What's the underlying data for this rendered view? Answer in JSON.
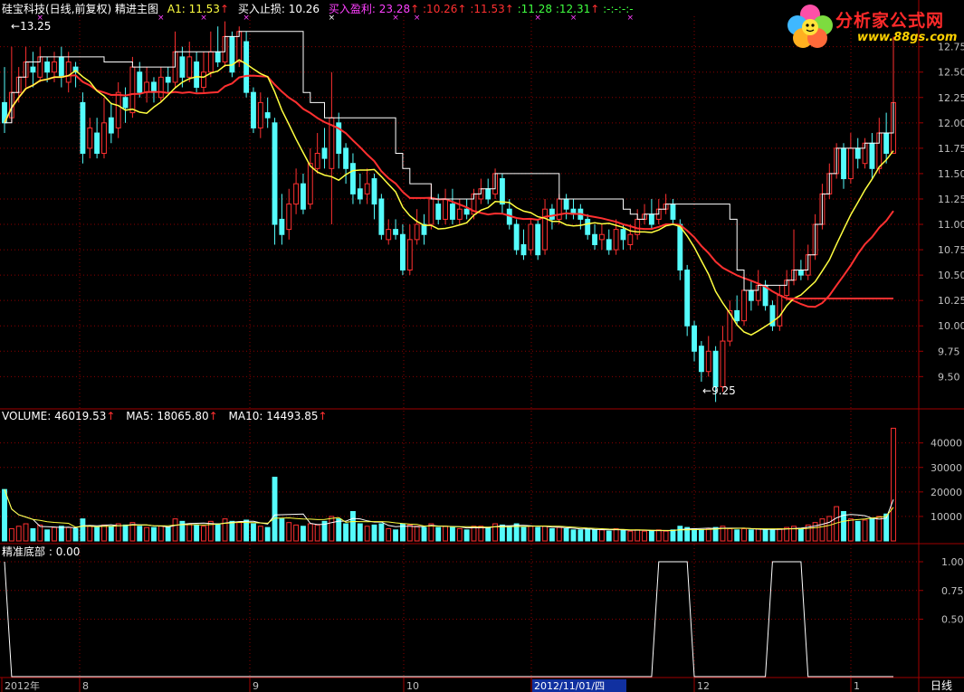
{
  "header": {
    "stock_title": "硅宝科技(日线,前复权)",
    "indicator_name": "精进主图",
    "a1_label": "A1:",
    "a1_value": "11.53",
    "stop_label": "买入止损:",
    "stop_value": "10.26",
    "profit_label": "买入盈利:",
    "profit_value": "23.28",
    "extra_values": [
      ":10.26",
      ":11.53",
      ":11.28",
      ":12.31",
      ":-",
      ":-",
      ":-",
      ":-"
    ],
    "up_arrow": "↑"
  },
  "annotations": {
    "high_label": "13.25",
    "low_label": "9.25"
  },
  "price_axis": [
    "12.75",
    "12.50",
    "12.25",
    "12.00",
    "11.75",
    "11.50",
    "11.25",
    "11.00",
    "10.75",
    "10.50",
    "10.25",
    "10.00",
    "9.75",
    "9.50"
  ],
  "volume_header": {
    "volume_label": "VOLUME:",
    "volume_value": "46019.53",
    "ma5_label": "MA5:",
    "ma5_value": "18065.80",
    "ma10_label": "MA10:",
    "ma10_value": "14493.85"
  },
  "volume_axis": [
    "40000",
    "30000",
    "20000",
    "10000"
  ],
  "bottom_header": {
    "label": "精准底部",
    "value": ": 0.00"
  },
  "bottom_axis": [
    "1.00",
    "0.75",
    "0.50"
  ],
  "date_axis": {
    "labels": [
      "2012年",
      "8",
      "9",
      "10",
      "2012/11/01/四",
      "12",
      "1"
    ],
    "period": "日线"
  },
  "logo": {
    "title": "分析家公式网",
    "url": "www.88gs.com"
  },
  "colors": {
    "up": "#ff3030",
    "down": "#54fcfc",
    "ma_yellow": "#ffff40",
    "stop_white": "#ffffff",
    "grid": "#8b0000",
    "axis": "#a00000",
    "magenta": "#ff40ff",
    "green": "#40ff40"
  },
  "chart_data": {
    "type": "candlestick",
    "ylim": [
      9.2,
      13.1
    ],
    "volume_ylim": [
      0,
      48000
    ],
    "candles": [
      [
        12.2,
        12.0,
        12.55,
        11.9,
        21000
      ],
      [
        12.05,
        12.3,
        12.75,
        12.0,
        5000
      ],
      [
        12.3,
        12.45,
        12.55,
        12.2,
        6000
      ],
      [
        12.45,
        12.6,
        12.75,
        12.35,
        7000
      ],
      [
        12.55,
        12.5,
        12.7,
        12.35,
        5000
      ],
      [
        12.45,
        12.65,
        12.75,
        12.4,
        6500
      ],
      [
        12.6,
        12.5,
        12.65,
        12.4,
        4500
      ],
      [
        12.5,
        12.6,
        12.7,
        12.4,
        5500
      ],
      [
        12.65,
        12.45,
        12.75,
        12.35,
        6000
      ],
      [
        12.4,
        12.6,
        12.7,
        12.3,
        5500
      ],
      [
        12.55,
        12.5,
        12.6,
        12.35,
        5000
      ],
      [
        12.2,
        11.7,
        12.3,
        11.6,
        9000
      ],
      [
        11.75,
        11.95,
        12.05,
        11.65,
        6000
      ],
      [
        11.9,
        11.7,
        12.05,
        11.65,
        5500
      ],
      [
        11.7,
        12.0,
        12.25,
        11.65,
        6500
      ],
      [
        12.05,
        11.9,
        12.2,
        11.8,
        6000
      ],
      [
        11.95,
        12.3,
        12.4,
        11.85,
        7000
      ],
      [
        12.25,
        12.15,
        12.35,
        12.0,
        6500
      ],
      [
        12.1,
        12.55,
        12.65,
        12.05,
        7500
      ],
      [
        12.5,
        12.3,
        12.6,
        12.25,
        6000
      ],
      [
        12.3,
        12.4,
        12.55,
        12.2,
        5500
      ],
      [
        12.4,
        12.3,
        12.45,
        12.2,
        5500
      ],
      [
        12.25,
        12.45,
        12.55,
        12.2,
        6000
      ],
      [
        12.45,
        12.4,
        12.55,
        12.3,
        5500
      ],
      [
        12.4,
        12.7,
        12.9,
        12.35,
        9000
      ],
      [
        12.65,
        12.45,
        12.75,
        12.35,
        8000
      ],
      [
        12.45,
        12.65,
        12.8,
        12.4,
        7000
      ],
      [
        12.6,
        12.35,
        12.7,
        12.3,
        6500
      ],
      [
        12.35,
        12.5,
        12.7,
        12.3,
        6000
      ],
      [
        12.5,
        12.7,
        12.9,
        12.45,
        8000
      ],
      [
        12.7,
        12.6,
        12.95,
        12.55,
        7000
      ],
      [
        12.6,
        12.85,
        13.0,
        12.55,
        9000
      ],
      [
        12.85,
        12.5,
        12.9,
        12.45,
        8000
      ],
      [
        12.6,
        12.9,
        12.95,
        12.55,
        7500
      ],
      [
        12.8,
        12.3,
        12.9,
        12.25,
        8500
      ],
      [
        12.3,
        11.95,
        12.35,
        11.9,
        7000
      ],
      [
        11.95,
        12.2,
        12.3,
        11.85,
        6000
      ],
      [
        12.1,
        12.05,
        12.25,
        11.95,
        5500
      ],
      [
        12.0,
        11.0,
        12.05,
        10.8,
        26000
      ],
      [
        11.05,
        10.9,
        11.3,
        10.8,
        9000
      ],
      [
        10.95,
        11.2,
        11.35,
        10.85,
        7500
      ],
      [
        11.2,
        11.4,
        11.55,
        11.1,
        6500
      ],
      [
        11.4,
        11.15,
        11.5,
        11.1,
        6000
      ],
      [
        11.2,
        11.6,
        11.75,
        11.15,
        7000
      ],
      [
        11.55,
        11.7,
        11.9,
        11.5,
        6500
      ],
      [
        11.75,
        11.65,
        11.95,
        11.55,
        8000
      ],
      [
        11.55,
        12.05,
        12.5,
        11.0,
        10000
      ],
      [
        12.0,
        11.7,
        12.1,
        11.55,
        9000
      ],
      [
        11.75,
        11.55,
        11.8,
        11.4,
        7000
      ],
      [
        11.6,
        11.3,
        11.7,
        11.2,
        12000
      ],
      [
        11.35,
        11.25,
        11.5,
        11.2,
        7000
      ],
      [
        11.3,
        11.4,
        11.55,
        11.2,
        6000
      ],
      [
        11.45,
        11.2,
        11.5,
        11.05,
        6500
      ],
      [
        11.25,
        10.9,
        11.3,
        10.85,
        7000
      ],
      [
        10.85,
        10.95,
        11.05,
        10.8,
        5000
      ],
      [
        10.95,
        10.9,
        11.05,
        10.85,
        4500
      ],
      [
        10.9,
        10.55,
        11.0,
        10.5,
        7000
      ],
      [
        10.55,
        10.85,
        11.0,
        10.5,
        6500
      ],
      [
        10.85,
        11.0,
        11.15,
        10.8,
        6000
      ],
      [
        11.0,
        10.9,
        11.1,
        10.8,
        5500
      ],
      [
        11.0,
        11.25,
        11.4,
        10.95,
        7000
      ],
      [
        11.2,
        11.05,
        11.3,
        11.0,
        5500
      ],
      [
        11.05,
        11.25,
        11.35,
        11.0,
        6000
      ],
      [
        11.2,
        11.05,
        11.35,
        11.0,
        5500
      ],
      [
        11.05,
        11.15,
        11.25,
        11.0,
        5000
      ],
      [
        11.15,
        11.1,
        11.25,
        11.05,
        4500
      ],
      [
        11.1,
        11.3,
        11.35,
        11.05,
        6000
      ],
      [
        11.25,
        11.35,
        11.45,
        11.2,
        6000
      ],
      [
        11.35,
        11.25,
        11.45,
        11.2,
        5500
      ],
      [
        11.3,
        11.5,
        11.55,
        11.25,
        7000
      ],
      [
        11.45,
        11.2,
        11.5,
        11.1,
        6500
      ],
      [
        11.15,
        11.0,
        11.25,
        10.95,
        6000
      ],
      [
        11.0,
        10.75,
        11.05,
        10.7,
        7000
      ],
      [
        10.8,
        10.7,
        10.95,
        10.65,
        5500
      ],
      [
        10.75,
        11.0,
        11.05,
        10.7,
        6000
      ],
      [
        11.0,
        10.7,
        11.05,
        10.65,
        5500
      ],
      [
        10.75,
        11.15,
        11.25,
        10.7,
        6000
      ],
      [
        11.15,
        11.05,
        11.2,
        10.95,
        5000
      ],
      [
        11.05,
        11.25,
        11.3,
        11.0,
        5500
      ],
      [
        11.25,
        11.15,
        11.3,
        11.05,
        5000
      ],
      [
        11.15,
        11.1,
        11.25,
        11.05,
        4500
      ],
      [
        11.15,
        11.05,
        11.2,
        10.95,
        4500
      ],
      [
        11.05,
        10.9,
        11.1,
        10.85,
        5000
      ],
      [
        10.9,
        10.8,
        11.0,
        10.75,
        4500
      ],
      [
        10.85,
        10.9,
        11.0,
        10.75,
        4500
      ],
      [
        10.85,
        10.75,
        10.95,
        10.7,
        4000
      ],
      [
        10.75,
        10.95,
        11.05,
        10.7,
        5000
      ],
      [
        10.95,
        10.85,
        11.0,
        10.75,
        4500
      ],
      [
        10.8,
        10.9,
        11.0,
        10.75,
        4000
      ],
      [
        10.9,
        11.05,
        11.15,
        10.85,
        4500
      ],
      [
        11.05,
        11.1,
        11.2,
        11.0,
        4000
      ],
      [
        11.1,
        11.0,
        11.25,
        10.95,
        4000
      ],
      [
        11.05,
        11.15,
        11.25,
        11.0,
        4500
      ],
      [
        11.15,
        11.2,
        11.3,
        11.1,
        4000
      ],
      [
        11.2,
        11.05,
        11.25,
        11.0,
        4500
      ],
      [
        11.0,
        10.55,
        11.05,
        10.45,
        6000
      ],
      [
        10.55,
        10.0,
        10.6,
        9.9,
        5500
      ],
      [
        10.0,
        9.75,
        10.05,
        9.65,
        5000
      ],
      [
        9.8,
        9.55,
        9.85,
        9.45,
        4500
      ],
      [
        9.55,
        9.75,
        9.9,
        9.5,
        5000
      ],
      [
        9.75,
        9.4,
        9.8,
        9.25,
        5500
      ],
      [
        9.4,
        9.85,
        10.0,
        9.35,
        6000
      ],
      [
        9.85,
        10.15,
        10.25,
        9.8,
        5000
      ],
      [
        10.15,
        10.05,
        10.3,
        10.0,
        4500
      ],
      [
        10.05,
        10.35,
        10.45,
        10.0,
        5000
      ],
      [
        10.35,
        10.25,
        10.45,
        10.15,
        4500
      ],
      [
        10.25,
        10.4,
        10.55,
        10.2,
        5000
      ],
      [
        10.4,
        10.2,
        10.45,
        10.15,
        4500
      ],
      [
        10.2,
        10.0,
        10.25,
        9.95,
        4500
      ],
      [
        10.0,
        10.3,
        10.4,
        9.95,
        5000
      ],
      [
        10.3,
        10.45,
        10.55,
        10.25,
        5500
      ],
      [
        10.45,
        10.55,
        10.95,
        10.4,
        6000
      ],
      [
        10.55,
        10.5,
        10.65,
        10.45,
        5000
      ],
      [
        10.5,
        10.7,
        10.8,
        10.45,
        6500
      ],
      [
        10.7,
        11.0,
        11.1,
        10.65,
        7500
      ],
      [
        11.0,
        11.3,
        11.4,
        10.95,
        9000
      ],
      [
        11.3,
        11.5,
        11.6,
        11.25,
        10000
      ],
      [
        11.5,
        11.75,
        11.8,
        11.45,
        14000
      ],
      [
        11.75,
        11.45,
        11.8,
        11.35,
        12000
      ],
      [
        11.45,
        11.75,
        11.9,
        11.4,
        9000
      ],
      [
        11.75,
        11.65,
        11.85,
        11.55,
        8000
      ],
      [
        11.6,
        11.8,
        11.85,
        11.55,
        8500
      ],
      [
        11.8,
        11.55,
        11.9,
        11.45,
        9000
      ],
      [
        11.55,
        11.9,
        12.05,
        11.5,
        10000
      ],
      [
        11.9,
        11.7,
        12.1,
        11.6,
        11000
      ],
      [
        11.7,
        12.2,
        12.85,
        11.95,
        46000
      ]
    ],
    "stop_line_steps": [
      [
        0,
        12.15
      ],
      [
        20,
        12.15
      ],
      [
        22,
        12.45
      ],
      [
        37,
        12.45
      ],
      [
        39,
        12.45
      ],
      [
        39,
        12.45
      ],
      [
        40,
        12.45
      ],
      [
        40,
        12.45
      ],
      [
        50,
        12.45
      ],
      [
        50,
        12.45
      ]
    ],
    "bottom_signal_spikes": [
      [
        0,
        1.0
      ],
      [
        1,
        0
      ],
      [
        93,
        1.0
      ],
      [
        97,
        0
      ],
      [
        109,
        1.0
      ],
      [
        113,
        0
      ]
    ]
  }
}
